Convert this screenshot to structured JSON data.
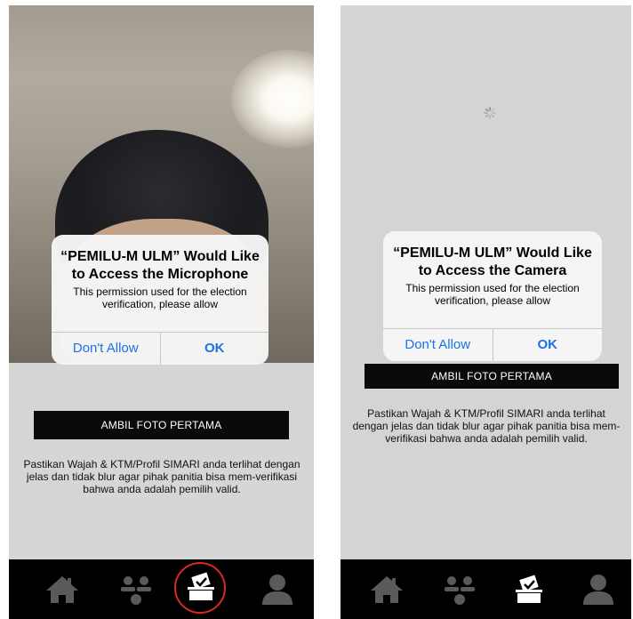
{
  "screens": [
    {
      "alert": {
        "title": "“PEMILU-M ULM” Would Like to Access the Microphone",
        "message": "This permission used for the election verification, please allow",
        "deny_label": "Don't Allow",
        "ok_label": "OK"
      },
      "photo_button_label": "AMBIL FOTO PERTAMA",
      "instructions": "Pastikan Wajah & KTM/Profil SIMARI anda terlihat dengan jelas dan tidak blur agar pihak panitia bisa mem-verifikasi bahwa anda adalah pemilih valid.",
      "tabs": [
        {
          "icon": "home-icon",
          "active": false
        },
        {
          "icon": "candidates-icon",
          "active": false
        },
        {
          "icon": "ballot-box-icon",
          "active": true,
          "highlighted": true
        },
        {
          "icon": "profile-icon",
          "active": false
        }
      ]
    },
    {
      "alert": {
        "title": "“PEMILU-M ULM” Would Like to Access the Camera",
        "message": "This permission used for the election verification, please allow",
        "deny_label": "Don't Allow",
        "ok_label": "OK"
      },
      "photo_button_label": "AMBIL FOTO PERTAMA",
      "instructions": "Pastikan Wajah & KTM/Profil SIMARI anda terlihat dengan jelas dan tidak blur agar pihak panitia bisa mem-verifikasi bahwa anda adalah pemilih valid.",
      "loading": true,
      "tabs": [
        {
          "icon": "home-icon",
          "active": false
        },
        {
          "icon": "candidates-icon",
          "active": false
        },
        {
          "icon": "ballot-box-icon",
          "active": true,
          "highlighted": false
        },
        {
          "icon": "profile-icon",
          "active": false
        }
      ]
    }
  ],
  "colors": {
    "alert_button_blue": "#1a72e8",
    "tab_highlight_red": "#d92828",
    "tab_icon_gray": "#5a5a5a",
    "tab_icon_active": "#ffffff"
  }
}
